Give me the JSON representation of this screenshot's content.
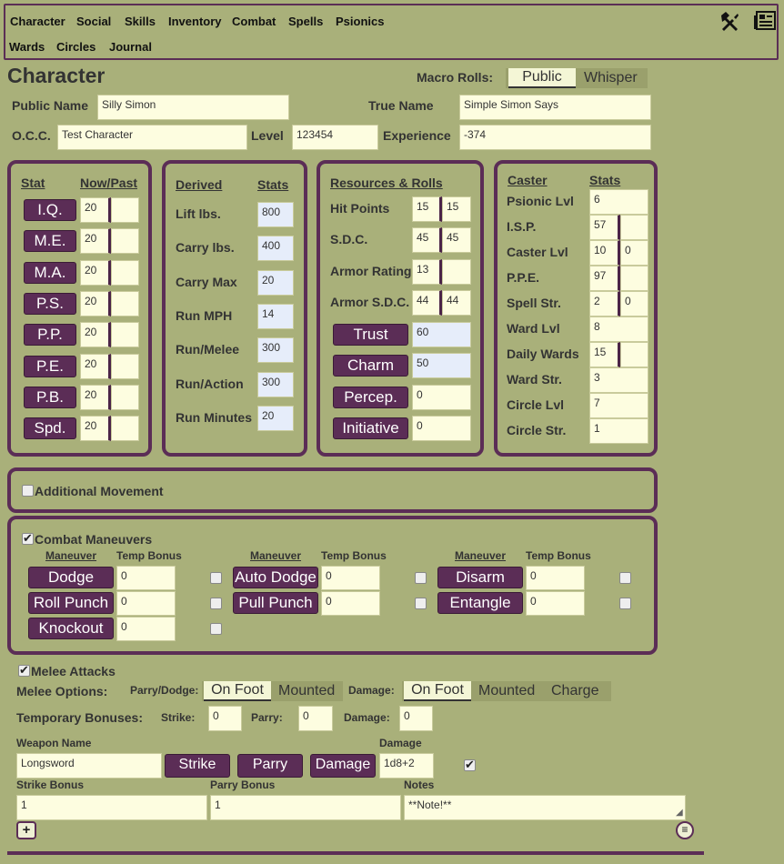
{
  "nav": {
    "tabs": [
      "Character",
      "Social",
      "Skills",
      "Inventory",
      "Combat",
      "Spells",
      "Psionics",
      "Wards",
      "Circles",
      "Journal"
    ]
  },
  "page_title": "Character",
  "macro_rolls": {
    "label": "Macro Rolls:",
    "options": [
      "Public",
      "Whisper"
    ],
    "selected": "Public"
  },
  "identity": {
    "public_name_label": "Public Name",
    "public_name": "Silly Simon",
    "true_name_label": "True Name",
    "true_name": "Simple Simon Says",
    "occ_label": "O.C.C.",
    "occ": "Test Character",
    "level_label": "Level",
    "level": "123454",
    "experience_label": "Experience",
    "experience": "-374"
  },
  "stats": {
    "header_stat": "Stat",
    "header_now": "Now/Past",
    "rows": [
      {
        "name": "I.Q.",
        "now": "20",
        "past": ""
      },
      {
        "name": "M.E.",
        "now": "20",
        "past": ""
      },
      {
        "name": "M.A.",
        "now": "20",
        "past": ""
      },
      {
        "name": "P.S.",
        "now": "20",
        "past": ""
      },
      {
        "name": "P.P.",
        "now": "20",
        "past": ""
      },
      {
        "name": "P.E.",
        "now": "20",
        "past": ""
      },
      {
        "name": "P.B.",
        "now": "20",
        "past": ""
      },
      {
        "name": "Spd.",
        "now": "20",
        "past": ""
      }
    ]
  },
  "derived": {
    "header_left": "Derived",
    "header_right": "Stats",
    "rows": [
      {
        "label": "Lift lbs.",
        "value": "800"
      },
      {
        "label": "Carry lbs.",
        "value": "400"
      },
      {
        "label": "Carry Max",
        "value": "20"
      },
      {
        "label": "Run MPH",
        "value": "14"
      },
      {
        "label": "Run/Melee",
        "value": "300"
      },
      {
        "label": "Run/Action",
        "value": "300"
      },
      {
        "label": "Run Minutes",
        "value": "20"
      }
    ]
  },
  "resources": {
    "header": "Resources & Rolls",
    "rows": [
      {
        "label": "Hit Points",
        "a": "15",
        "b": "15"
      },
      {
        "label": "S.D.C.",
        "a": "45",
        "b": "45"
      },
      {
        "label": "Armor Rating",
        "a": "13",
        "b": ""
      },
      {
        "label": "Armor S.D.C.",
        "a": "44",
        "b": "44"
      }
    ],
    "rolls": [
      {
        "label": "Trust",
        "value": "60"
      },
      {
        "label": "Charm",
        "value": "50"
      },
      {
        "label": "Percep.",
        "value": "0"
      },
      {
        "label": "Initiative",
        "value": "0"
      }
    ]
  },
  "caster": {
    "header_left": "Caster",
    "header_right": "Stats",
    "rows": [
      {
        "label": "Psionic Lvl",
        "a": "6",
        "b": null
      },
      {
        "label": "I.S.P.",
        "a": "57",
        "b": ""
      },
      {
        "label": "Caster Lvl",
        "a": "10",
        "b": "0"
      },
      {
        "label": "P.P.E.",
        "a": "97",
        "b": ""
      },
      {
        "label": "Spell Str.",
        "a": "2",
        "b": "0"
      },
      {
        "label": "Ward Lvl",
        "a": "8",
        "b": null
      },
      {
        "label": "Daily Wards",
        "a": "15",
        "b": ""
      },
      {
        "label": "Ward Str.",
        "a": "3",
        "b": null
      },
      {
        "label": "Circle Lvl",
        "a": "7",
        "b": null
      },
      {
        "label": "Circle Str.",
        "a": "1",
        "b": null
      }
    ]
  },
  "additional_movement": {
    "label": "Additional Movement",
    "checked": false
  },
  "combat_maneuvers": {
    "label": "Combat Maneuvers",
    "checked": true,
    "col_maneuver": "Maneuver",
    "col_temp": "Temp Bonus",
    "items": [
      {
        "name": "Dodge",
        "bonus": "0"
      },
      {
        "name": "Auto Dodge",
        "bonus": "0"
      },
      {
        "name": "Disarm",
        "bonus": "0"
      },
      {
        "name": "Roll Punch",
        "bonus": "0"
      },
      {
        "name": "Pull Punch",
        "bonus": "0"
      },
      {
        "name": "Entangle",
        "bonus": "0"
      },
      {
        "name": "Knockout",
        "bonus": "0"
      }
    ]
  },
  "melee": {
    "label": "Melee Attacks",
    "checked": true,
    "options_label": "Melee Options:",
    "parry_label": "Parry/Dodge:",
    "parry_options": [
      "On Foot",
      "Mounted"
    ],
    "parry_selected": "On Foot",
    "damage_label": "Damage:",
    "damage_options": [
      "On Foot",
      "Mounted",
      "Charge"
    ],
    "damage_selected": "On Foot",
    "temp_label": "Temporary Bonuses:",
    "strike_label": "Strike:",
    "strike": "0",
    "parry_b_label": "Parry:",
    "parry": "0",
    "damage_b_label": "Damage:",
    "damage": "0",
    "weapon_name_label": "Weapon Name",
    "weapon_name": "Longsword",
    "strike_btn": "Strike",
    "parry_btn": "Parry",
    "damage_btn": "Damage",
    "damage_col_label": "Damage",
    "damage_value": "1d8+2",
    "strike_bonus_label": "Strike Bonus",
    "strike_bonus": "1",
    "parry_bonus_label": "Parry Bonus",
    "parry_bonus": "1",
    "notes_label": "Notes",
    "notes": "**Note!**"
  },
  "colors": {
    "background": "#a9b07a",
    "accent": "#5b2d56",
    "input": "#fdfde0",
    "derived_input": "#e6edfa"
  }
}
